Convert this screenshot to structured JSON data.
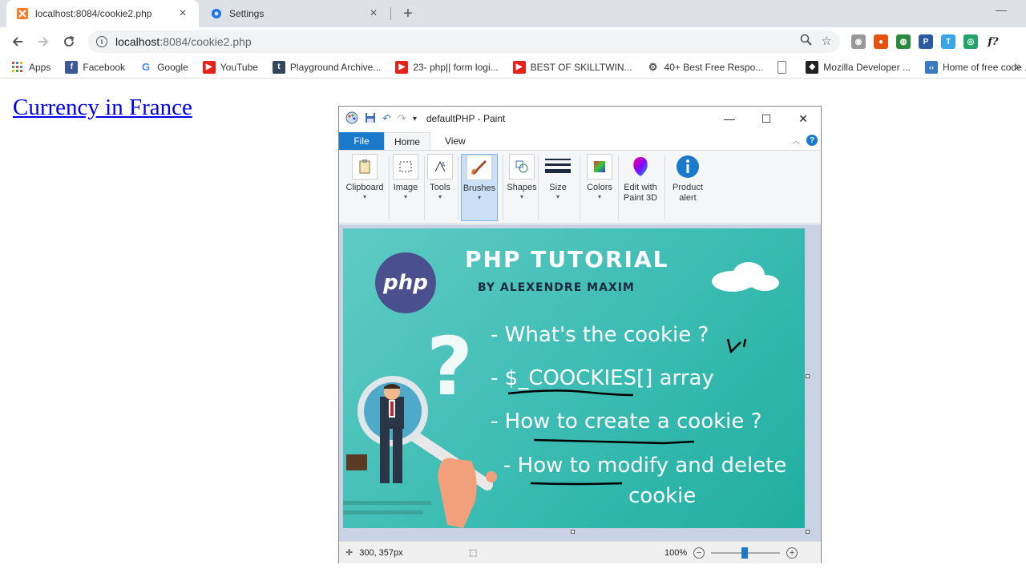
{
  "browser": {
    "tabs": [
      {
        "label": "localhost:8084/cookie2.php",
        "active": true
      },
      {
        "label": "Settings",
        "active": false
      }
    ],
    "address": {
      "host": "localhost",
      "rest": ":8084/cookie2.php"
    },
    "bookmarks": [
      {
        "label": "Apps",
        "icon": "apps-grid-icon",
        "color": "#4285f4"
      },
      {
        "label": "Facebook",
        "icon": "facebook-icon",
        "color": "#3b5998"
      },
      {
        "label": "Google",
        "icon": "google-icon",
        "color": "#ea4335"
      },
      {
        "label": "YouTube",
        "icon": "youtube-icon",
        "color": "#e62117"
      },
      {
        "label": "Playground Archive...",
        "icon": "tumblr-icon",
        "color": "#35465c"
      },
      {
        "label": "23- php|| form logi...",
        "icon": "youtube-icon",
        "color": "#e62117"
      },
      {
        "label": "BEST OF SKILLTWIN...",
        "icon": "youtube-icon",
        "color": "#e62117"
      },
      {
        "label": "40+ Best Free Respo...",
        "icon": "gear-icon",
        "color": "#666666"
      },
      {
        "label": "",
        "icon": "page-icon",
        "color": "#999999"
      },
      {
        "label": "Mozilla Developer ...",
        "icon": "mozilla-icon",
        "color": "#222222"
      },
      {
        "label": "Home of free code ...",
        "icon": "freecodecamp-icon",
        "color": "#3b7bbf"
      }
    ]
  },
  "page": {
    "link_text": "Currency in France"
  },
  "paint": {
    "title": "defaultPHP - Paint",
    "tabs": {
      "file": "File",
      "home": "Home",
      "view": "View"
    },
    "groups": [
      {
        "label": "Clipboard",
        "caret": true
      },
      {
        "label": "Image",
        "caret": true
      },
      {
        "label": "Tools",
        "caret": true
      },
      {
        "label": "Brushes",
        "caret": true,
        "selected": true
      },
      {
        "label": "Shapes",
        "caret": true
      },
      {
        "label": "Size",
        "caret": true
      },
      {
        "label": "Colors",
        "caret": true
      },
      {
        "label": "Edit with Paint 3D",
        "caret": false
      },
      {
        "label": "Product alert",
        "caret": false
      }
    ],
    "image": {
      "logo": "php",
      "title": "PHP TUTORIAL",
      "subtitle": "BY ALEXENDRE MAXIM",
      "bullets": [
        "- What's the cookie  ?",
        "- $_COOCKIES[] array",
        "- How to create a cookie ?",
        "- How to modify and delete",
        "cookie"
      ]
    },
    "status": {
      "position": "300, 357px",
      "zoom": "100%"
    }
  }
}
